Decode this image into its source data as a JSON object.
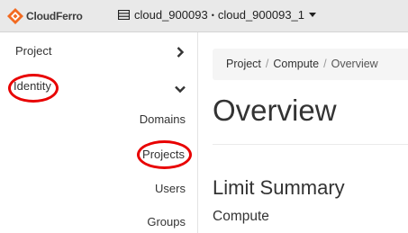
{
  "header": {
    "brand": "CloudFerro",
    "project_domain": "cloud_900093",
    "project_separator": "•",
    "project_name": "cloud_900093_1"
  },
  "sidebar": {
    "project_label": "Project",
    "identity_label": "Identity",
    "identity_items": [
      {
        "label": "Domains"
      },
      {
        "label": "Projects"
      },
      {
        "label": "Users"
      },
      {
        "label": "Groups"
      }
    ]
  },
  "breadcrumb": {
    "items": [
      "Project",
      "Compute",
      "Overview"
    ]
  },
  "main": {
    "title": "Overview",
    "section_title": "Limit Summary",
    "subsection_title": "Compute"
  },
  "annotation_color": "#e80000",
  "brand_color": "#f26a21"
}
